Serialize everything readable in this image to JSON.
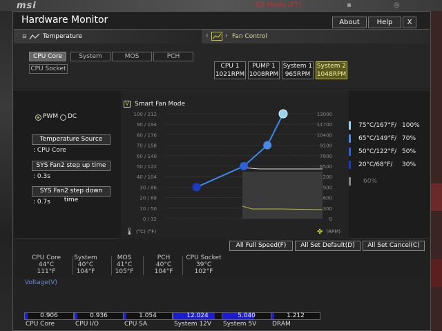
{
  "bios": {
    "ez_mode": "EZ Mode (F7)"
  },
  "window": {
    "title": "Hardware Monitor",
    "buttons": {
      "about": "About",
      "help": "Help",
      "close": "X"
    }
  },
  "temperature": {
    "label": "Temperature",
    "tabs": [
      "CPU Core",
      "System",
      "MOS",
      "PCH",
      "CPU Socket"
    ],
    "active_tab": "CPU Core"
  },
  "fan_control": {
    "label": "Fan Control",
    "fans": [
      {
        "name": "CPU 1",
        "rpm": "1021RPM"
      },
      {
        "name": "PUMP 1",
        "rpm": "1008RPM"
      },
      {
        "name": "System 1",
        "rpm": "965RPM"
      },
      {
        "name": "System 2",
        "rpm": "1048RPM"
      }
    ],
    "active_fan": "System 2"
  },
  "mode": {
    "pwm": "PWM",
    "dc": "DC",
    "selected": "PWM",
    "smart_fan_label": "Smart Fan Mode",
    "smart_fan_checked": "V",
    "temp_source_label": "Temperature Source",
    "temp_source_value": ": CPU Core",
    "step_up_label": "SYS Fan2 step up time",
    "step_up_value": ": 0.3s",
    "step_down_label": "SYS Fan2 step down time",
    "step_down_value": ": 0.7s"
  },
  "chart_data": {
    "type": "line",
    "left_ticks": [
      "100 / 212",
      "90 / 194",
      "80 / 176",
      "70 / 158",
      "60 / 140",
      "50 / 122",
      "40 / 104",
      "30 / 86",
      "20 / 68",
      "10 / 50",
      "0 / 32"
    ],
    "right_ticks": [
      "13000",
      "11700",
      "10400",
      "9100",
      "7800",
      "6500",
      "5200",
      "3900",
      "2600",
      "1300",
      "0"
    ],
    "x_unit_label": "(°C) (°F)",
    "y_unit_label": "(RPM)",
    "xlim": [
      0,
      100
    ],
    "ylim": [
      0,
      100
    ],
    "curve_points": [
      {
        "temp_c": 20,
        "pct": 30
      },
      {
        "temp_c": 50,
        "pct": 50
      },
      {
        "temp_c": 65,
        "pct": 70
      },
      {
        "temp_c": 75,
        "pct": 100
      }
    ],
    "legend": [
      {
        "label": "75°C/167°F/",
        "pct": "100%",
        "color": "#9cd0f0"
      },
      {
        "label": "65°C/149°F/",
        "pct": "70%",
        "color": "#4a8ae0"
      },
      {
        "label": "50°C/122°F/",
        "pct": "50%",
        "color": "#2a60d8"
      },
      {
        "label": "20°C/68°F/",
        "pct": "30%",
        "color": "#1c3cc0"
      },
      {
        "label": "",
        "pct": "60%",
        "color": "#888888"
      }
    ]
  },
  "actions": {
    "full_speed": "All Full Speed(F)",
    "set_default": "All Set Default(D)",
    "set_cancel": "All Set Cancel(C)"
  },
  "temps": [
    {
      "name": "CPU Core",
      "c": "44°C",
      "f": "111°F"
    },
    {
      "name": "System",
      "c": "40°C",
      "f": "104°F"
    },
    {
      "name": "MOS",
      "c": "41°C",
      "f": "105°F"
    },
    {
      "name": "PCH",
      "c": "40°C",
      "f": "104°F"
    },
    {
      "name": "CPU Socket",
      "c": "39°C",
      "f": "102°F"
    }
  ],
  "voltage": {
    "label": "Voltage(V)",
    "items": [
      {
        "name": "CPU Core",
        "value": "0.906",
        "fill": 0.05
      },
      {
        "name": "CPU I/O",
        "value": "0.936",
        "fill": 0.05
      },
      {
        "name": "CPU SA",
        "value": "1.054",
        "fill": 0.06
      },
      {
        "name": "System 12V",
        "value": "12.024",
        "fill": 0.85
      },
      {
        "name": "System 5V",
        "value": "5.040",
        "fill": 0.65
      },
      {
        "name": "DRAM",
        "value": "1.212",
        "fill": 0.06
      }
    ]
  }
}
